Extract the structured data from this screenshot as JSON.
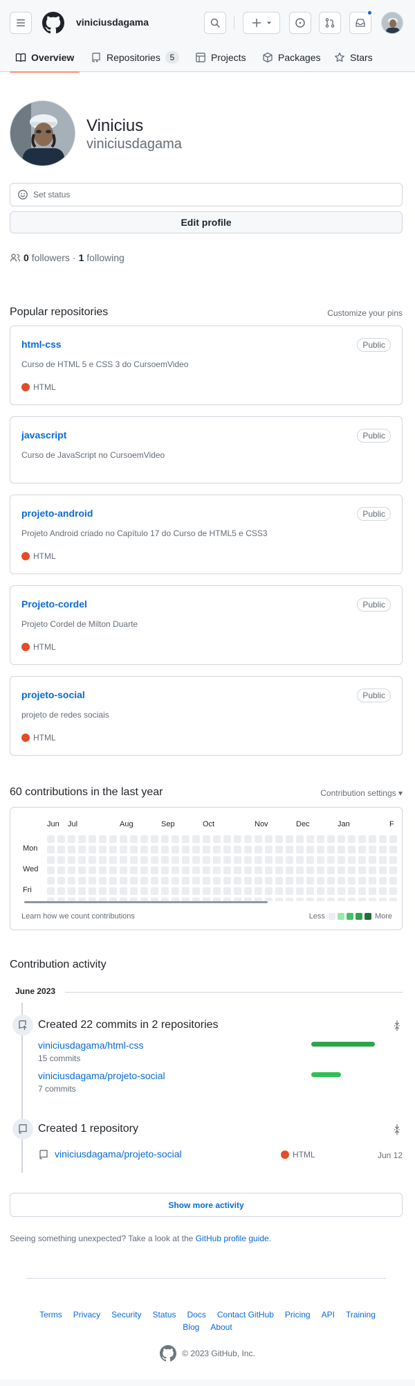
{
  "header": {
    "username": "viniciusdagama",
    "tabs": [
      {
        "label": "Overview",
        "icon": "book-icon"
      },
      {
        "label": "Repositories",
        "icon": "repo-icon",
        "count": "5"
      },
      {
        "label": "Projects",
        "icon": "table-icon"
      },
      {
        "label": "Packages",
        "icon": "package-icon"
      },
      {
        "label": "Stars",
        "icon": "star-icon"
      }
    ]
  },
  "profile": {
    "name": "Vinicius",
    "login": "viniciusdagama",
    "status_label": "Set status",
    "edit_label": "Edit profile",
    "followers_count": "0",
    "followers_label": "followers",
    "separator": "·",
    "following_count": "1",
    "following_label": "following"
  },
  "pinned": {
    "title": "Popular repositories",
    "customize": "Customize your pins",
    "repos": [
      {
        "name": "html-css",
        "visibility": "Public",
        "description": "Curso de HTML 5 e CSS 3 do CursoemVideo",
        "language": "HTML"
      },
      {
        "name": "javascript",
        "visibility": "Public",
        "description": "Curso de JavaScript no CursoemVideo",
        "language": ""
      },
      {
        "name": "projeto-android",
        "visibility": "Public",
        "description": "Projeto Android criado no Capítulo 17 do Curso de HTML5 e CSS3",
        "language": "HTML"
      },
      {
        "name": "Projeto-cordel",
        "visibility": "Public",
        "description": "Projeto Cordel de Milton Duarte",
        "language": "HTML"
      },
      {
        "name": "projeto-social",
        "visibility": "Public",
        "description": "projeto de redes sociais",
        "language": "HTML"
      }
    ],
    "language_color": "#e34c26"
  },
  "contributions": {
    "title": "60 contributions in the last year",
    "settings": "Contribution settings ▾",
    "months": [
      "Jun",
      "Jul",
      "Aug",
      "Sep",
      "Oct",
      "Nov",
      "Dec",
      "Jan",
      "F"
    ],
    "days": [
      "Mon",
      "Wed",
      "Fri"
    ],
    "learn": "Learn how we count contributions",
    "less": "Less",
    "more": "More",
    "legend_colors": [
      "#ebedf0",
      "#9be9a8",
      "#40c463",
      "#30a14e",
      "#216e39"
    ]
  },
  "activity": {
    "title": "Contribution activity",
    "month": "June 2023",
    "commits": {
      "title": "Created 22 commits in 2 repositories",
      "repos": [
        {
          "name": "viniciusdagama/html-css",
          "commits": "15 commits",
          "share": 1.0
        },
        {
          "name": "viniciusdagama/projeto-social",
          "commits": "7 commits",
          "share": 0.47
        }
      ]
    },
    "created": {
      "title": "Created 1 repository",
      "repo": "viniciusdagama/projeto-social",
      "language": "HTML",
      "date": "Jun 12"
    },
    "show_more": "Show more activity",
    "unexpected_text": "Seeing something unexpected? Take a look at the ",
    "unexpected_link": "GitHub profile guide",
    "unexpected_end": "."
  },
  "footer": {
    "links": [
      "Terms",
      "Privacy",
      "Security",
      "Status",
      "Docs",
      "Contact GitHub",
      "Pricing",
      "API",
      "Training",
      "Blog",
      "About"
    ],
    "copyright": "© 2023 GitHub, Inc."
  }
}
